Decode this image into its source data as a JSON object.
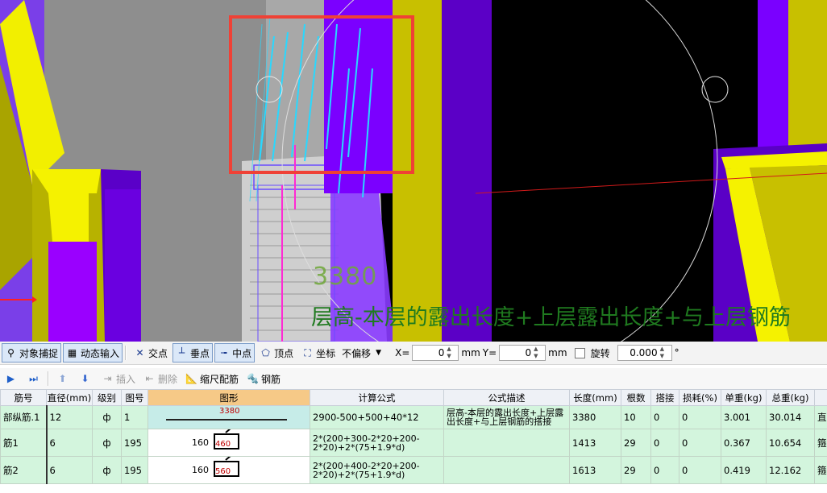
{
  "viewport": {
    "dimension_label": "3380",
    "formula_overlay": "层高-本层的露出长度+上层露出长度+与上层钢筋"
  },
  "snap_toolbar": {
    "object_snap": "对象捕捉",
    "dynamic_input": "动态输入",
    "intersection": "交点",
    "perpendicular": "垂点",
    "midpoint": "中点",
    "vertex": "顶点",
    "coordinate": "坐标",
    "offset_mode": "不偏移",
    "x_label": "X=",
    "x_value": "0",
    "x_unit": "mm",
    "y_label": "Y=",
    "y_value": "0",
    "y_unit": "mm",
    "rotate_label": "旋转",
    "rotate_value": "0.000",
    "rotate_unit": "°"
  },
  "action_toolbar": {
    "insert": "插入",
    "delete": "删除",
    "scale_rebar": "缩尺配筋",
    "rebar": "钢筋"
  },
  "grid": {
    "headers": [
      "筋号",
      "直径(mm)",
      "级别",
      "图号",
      "图形",
      "计算公式",
      "公式描述",
      "长度(mm)",
      "根数",
      "搭接",
      "损耗(%)",
      "单重(kg)",
      "总重(kg)",
      ""
    ],
    "rows": [
      {
        "name": "部纵筋.1",
        "diameter": "12",
        "grade": "ф",
        "figure_no": "1",
        "shape_length": "3380",
        "formula": "2900-500+500+40*12",
        "description": "层高-本层的露出长度+上层露出长度+与上层钢筋的搭接",
        "length": "3380",
        "count": "10",
        "lap": "0",
        "loss": "0",
        "unit_weight": "3.001",
        "total_weight": "30.014",
        "extra": "直"
      },
      {
        "name": "筋1",
        "diameter": "6",
        "grade": "ф",
        "figure_no": "195",
        "shape_width": "160",
        "shape_height": "460",
        "formula": "2*(200+300-2*20+200-2*20)+2*(75+1.9*d)",
        "description": "",
        "length": "1413",
        "count": "29",
        "lap": "0",
        "loss": "0",
        "unit_weight": "0.367",
        "total_weight": "10.654",
        "extra": "箍"
      },
      {
        "name": "筋2",
        "diameter": "6",
        "grade": "ф",
        "figure_no": "195",
        "shape_width": "160",
        "shape_height": "560",
        "formula": "2*(200+400-2*20+200-2*20)+2*(75+1.9*d)",
        "description": "",
        "length": "1613",
        "count": "29",
        "lap": "0",
        "loss": "0",
        "unit_weight": "0.419",
        "total_weight": "12.162",
        "extra": "箍"
      }
    ]
  },
  "colors": {
    "column_yellow": "#c8c000",
    "column_purple": "#6a00e0",
    "rebar_cyan": "#29d8ff",
    "highlight_red": "#ef4136",
    "grid_row_green": "#d3f5dd",
    "selected_header": "#f6c987"
  }
}
